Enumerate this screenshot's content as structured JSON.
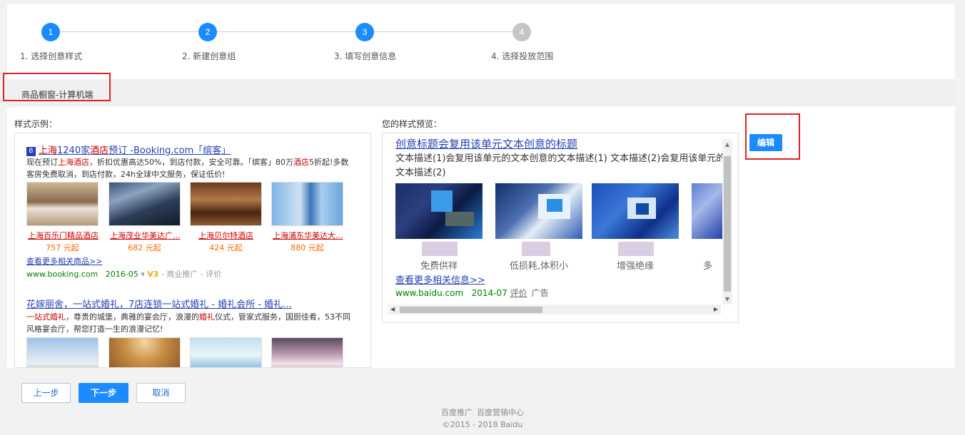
{
  "steps": [
    {
      "num": "1",
      "label": "1. 选择创意样式",
      "state": "active"
    },
    {
      "num": "2",
      "label": "2. 新建创意组",
      "state": "active"
    },
    {
      "num": "3",
      "label": "3. 填写创意信息",
      "state": "active"
    },
    {
      "num": "4",
      "label": "4. 选择投放范围",
      "state": "inactive"
    }
  ],
  "section_title": "商品橱窗-计算机端",
  "sample_label": "样式示例：",
  "preview_label": "您的样式预览：",
  "edit_button": "编辑",
  "sample": {
    "result1": {
      "badge": "B",
      "title_parts": [
        "上海",
        "1240家",
        "酒店",
        "预订 -Booking.com「缤客」"
      ],
      "desc_line1_a": "现在预订",
      "desc_line1_em": "上海酒店",
      "desc_line1_b": "，折扣优惠高达50%，到店付款，安全可靠。「缤客」80万",
      "desc_line1_em2": "酒店",
      "desc_line1_c": "5折起!多数",
      "desc_line2": "客房免费取消，到店付款，24h全球中文服务，保证低价!",
      "items": [
        {
          "name": "上海百乐门精品酒店",
          "price": "757 元起"
        },
        {
          "name": "上海茂业华美达广...",
          "price": "682 元起"
        },
        {
          "name": "上海贝尔特酒店",
          "price": "424 元起"
        },
        {
          "name": "上海浦东华美达大...",
          "price": "880 元起"
        }
      ],
      "more": "查看更多相关商品>>",
      "url": "www.booking.com",
      "date": "2016-05",
      "v3": "V3",
      "tail": "- 商业推广 - 评价"
    },
    "result2": {
      "title": "花嫁丽舍，一站式婚礼，7店连锁一站式婚礼 - 婚礼会所 - 婚礼...",
      "desc_em": "一站式婚礼",
      "desc_a": "，尊贵的城堡，典雅的宴会厅，浪漫的",
      "desc_em2": "婚礼",
      "desc_b": "仪式，管家式服务，国厨佳肴，53不同",
      "desc_line2": "风格宴会厅，帮您打造一生的浪漫记忆!"
    }
  },
  "preview": {
    "title": "创意标题会复用该单元文本创意的标题",
    "desc": "文本描述(1)会复用该单元的文本创意的文本描述(1)  文本描述(2)会复用该单元的文本描述(2)",
    "captions": [
      "免费供祥",
      "低损耗,体积小",
      "增强绝缘",
      "多"
    ],
    "more": "查看更多相关信息>>",
    "url": "www.baidu.com",
    "date": "2014-07",
    "eval": "评价",
    "ad": "广告"
  },
  "buttons": {
    "prev": "上一步",
    "next": "下一步",
    "cancel": "取消"
  },
  "footer": {
    "link1": "百度推广",
    "link2": "百度营销中心",
    "copyright": "©2015 - 2018 Baidu"
  },
  "colors": {
    "accent": "#1a8cff",
    "highlight_box": "#e32222",
    "link": "#2440b3",
    "url_green": "#008000"
  }
}
